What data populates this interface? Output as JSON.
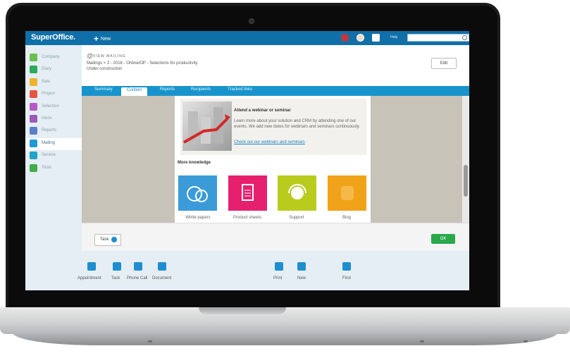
{
  "topbar": {
    "brand": "SuperOffice.",
    "new_label": "New",
    "help_label": "Help",
    "search_placeholder": ""
  },
  "sidebar": {
    "items": [
      {
        "label": "Company",
        "icon": "company-icon",
        "color": "#6bbf4e"
      },
      {
        "label": "Diary",
        "icon": "diary-icon",
        "color": "#2eaa5c"
      },
      {
        "label": "Sale",
        "icon": "sale-icon",
        "color": "#f0b429"
      },
      {
        "label": "Project",
        "icon": "project-icon",
        "color": "#e8553d"
      },
      {
        "label": "Selection",
        "icon": "selection-icon",
        "color": "#b85bc9"
      },
      {
        "label": "Inbox",
        "icon": "inbox-icon",
        "color": "#9b59b6"
      },
      {
        "label": "Reports",
        "icon": "reports-icon",
        "color": "#5b7fc9"
      },
      {
        "label": "Mailing",
        "icon": "mailing-icon",
        "color": "#1f9ad6",
        "active": true
      },
      {
        "label": "Service",
        "icon": "service-icon",
        "color": "#1fa3c9"
      },
      {
        "label": "Tools",
        "icon": "tools-icon",
        "color": "#3fae49"
      }
    ]
  },
  "header": {
    "view_label": "VIEW MAILING",
    "breadcrumb": "Mailings  >  3 - 2016 - Online/OP - Selections for productivity",
    "status": "Under construction",
    "edit_label": "Edit"
  },
  "tabs": [
    "Summary",
    "Content",
    "Reports",
    "Recipients",
    "Tracked links"
  ],
  "active_tab": "Content",
  "content": {
    "promo_title": "Attend a webinar or seminar",
    "promo_body": "Learn more about your solution and CRM by attending one of our events. We add new dates for webinars and seminars continuously.",
    "promo_link": "Check out our webinars and seminars",
    "knowledge_title": "More knowledge",
    "tiles": [
      {
        "label": "White papers",
        "color": "#3a9bd8"
      },
      {
        "label": "Product sheets",
        "color": "#e6206f"
      },
      {
        "label": "Support",
        "color": "#b9cc1e"
      },
      {
        "label": "Blog",
        "color": "#f0a318"
      }
    ]
  },
  "footer": {
    "task_label": "Task",
    "ok_label": "OK"
  },
  "dock": {
    "left": [
      {
        "label": "Appointment",
        "icon": "calendar-icon"
      },
      {
        "label": "Task",
        "icon": "checkbox-icon"
      },
      {
        "label": "Phone Call",
        "icon": "phone-icon"
      },
      {
        "label": "Document",
        "icon": "pencil-icon"
      }
    ],
    "right": [
      {
        "label": "Print",
        "icon": "print-icon"
      },
      {
        "label": "New",
        "icon": "plus-icon"
      },
      {
        "label": "Find",
        "icon": "find-icon"
      }
    ]
  },
  "colors": {
    "brand": "#0f6fa8",
    "tabbar": "#1894cc",
    "ok": "#2aa84a"
  }
}
